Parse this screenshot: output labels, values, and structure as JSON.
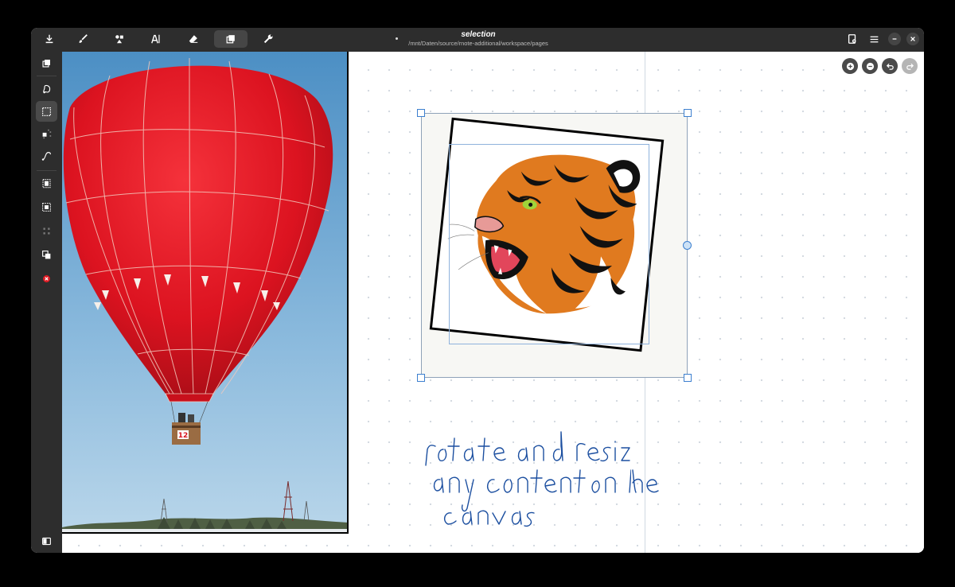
{
  "header": {
    "title": "selection",
    "path": "/mnt/Daten/source/rnote-additional/workspace/pages",
    "tools": [
      {
        "name": "save-icon"
      },
      {
        "name": "brush-icon"
      },
      {
        "name": "shaper-icon"
      },
      {
        "name": "typewriter-icon"
      },
      {
        "name": "eraser-icon"
      },
      {
        "name": "selector-icon",
        "active": true
      },
      {
        "name": "tools-icon"
      }
    ]
  },
  "sidebar": {
    "tools": [
      {
        "name": "selector-polygon-icon"
      },
      {
        "name": "selector-rectangle-icon",
        "active": true
      },
      {
        "name": "selector-single-icon"
      },
      {
        "name": "selector-intersecting-path-icon"
      }
    ],
    "actions": [
      {
        "name": "select-page-icon"
      },
      {
        "name": "select-all-icon"
      },
      {
        "name": "deselect-icon"
      },
      {
        "name": "duplicate-icon"
      },
      {
        "name": "delete-icon"
      }
    ]
  },
  "canvas": {
    "handwriting_lines": [
      "rotate and resize",
      "any content on the",
      "canvas"
    ],
    "ink_color": "#1c4fa0",
    "balloon_number": "12"
  },
  "colors": {
    "accent": "#3c7fcf",
    "header_bg": "#2d2d2d",
    "close_red": "#e01b24"
  }
}
